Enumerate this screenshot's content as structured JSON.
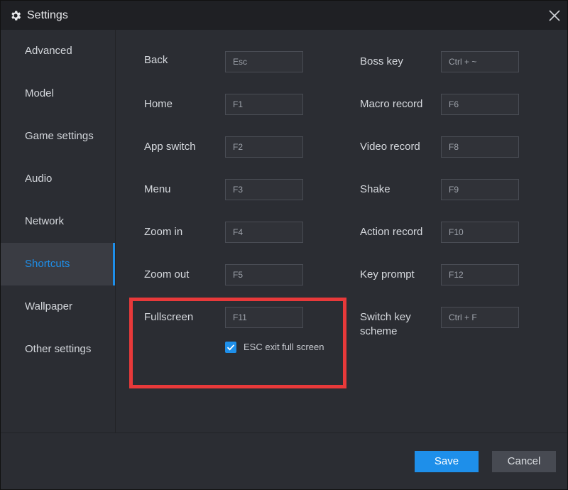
{
  "window": {
    "title": "Settings",
    "title_icon": "gear-icon",
    "close_icon": "close-icon"
  },
  "sidebar": {
    "items": [
      {
        "label": "Advanced"
      },
      {
        "label": "Model"
      },
      {
        "label": "Game settings"
      },
      {
        "label": "Audio"
      },
      {
        "label": "Network"
      },
      {
        "label": "Shortcuts",
        "active": true
      },
      {
        "label": "Wallpaper"
      },
      {
        "label": "Other settings"
      }
    ]
  },
  "shortcuts": {
    "left": [
      {
        "label": "Back",
        "key": "Esc"
      },
      {
        "label": "Home",
        "key": "F1"
      },
      {
        "label": "App switch",
        "key": "F2"
      },
      {
        "label": "Menu",
        "key": "F3"
      },
      {
        "label": "Zoom in",
        "key": "F4"
      },
      {
        "label": "Zoom out",
        "key": "F5"
      },
      {
        "label": "Fullscreen",
        "key": "F11"
      }
    ],
    "right": [
      {
        "label": "Boss key",
        "key": "Ctrl + ~"
      },
      {
        "label": "Macro record",
        "key": "F6"
      },
      {
        "label": "Video record",
        "key": "F8"
      },
      {
        "label": "Shake",
        "key": "F9"
      },
      {
        "label": "Action record",
        "key": "F10"
      },
      {
        "label": "Key prompt",
        "key": "F12"
      },
      {
        "label": "Switch key scheme",
        "key": "Ctrl + F"
      }
    ],
    "esc_exit": {
      "label": "ESC exit full screen",
      "checked": true
    }
  },
  "footer": {
    "save_label": "Save",
    "cancel_label": "Cancel"
  },
  "colors": {
    "accent": "#1e8fea",
    "highlight": "#e8393a",
    "background": "#2b2d33"
  }
}
